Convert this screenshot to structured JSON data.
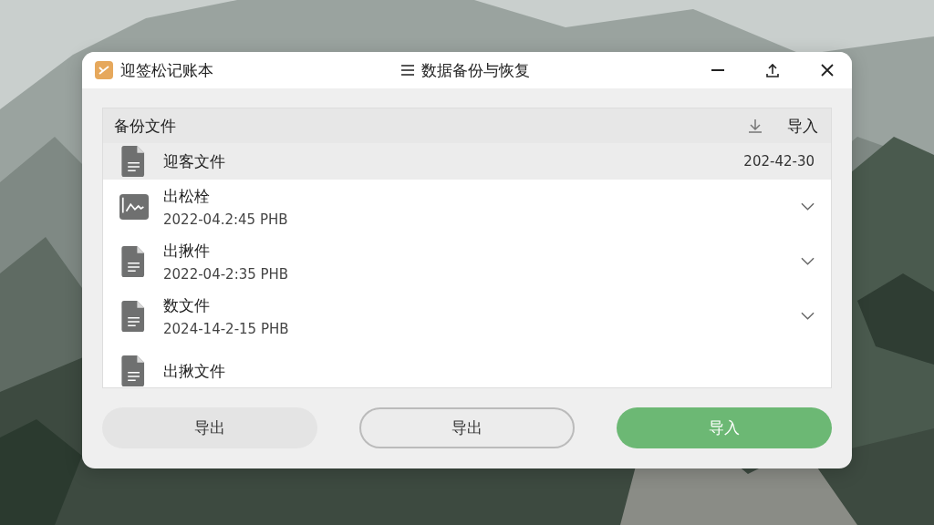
{
  "window": {
    "app_name": "迎签松记账本",
    "title": "数据备份与恢复"
  },
  "panel": {
    "heading": "备份文件",
    "import_label": "导入"
  },
  "files": [
    {
      "name": "迎客文件",
      "date": "202-42-30",
      "selected": true
    },
    {
      "name": "出松栓",
      "meta": "2022-04.2:45 PHB",
      "selected": false
    },
    {
      "name": "出揪件",
      "meta": "2022-04-2:35 PHB",
      "selected": false
    },
    {
      "name": "数文件",
      "meta": "2024-14-2-15 PHB",
      "selected": false
    },
    {
      "name": "出揪文件",
      "selected": false
    }
  ],
  "buttons": [
    {
      "label": "导出",
      "kind": "plain"
    },
    {
      "label": "导出",
      "kind": "outline"
    },
    {
      "label": "导入",
      "kind": "primary"
    }
  ]
}
